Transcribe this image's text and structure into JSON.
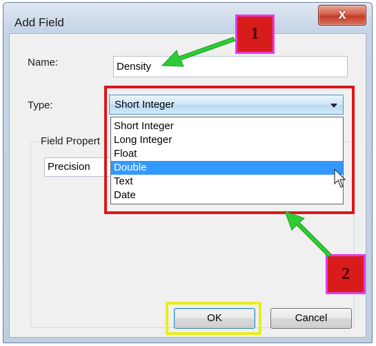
{
  "window": {
    "title": "Add Field",
    "close_label": "x"
  },
  "form": {
    "name_label": "Name:",
    "name_value": "Density",
    "type_label": "Type:",
    "type_selected": "Short Integer",
    "field_props_label": "Field Propert",
    "precision_label": "Precision"
  },
  "dropdown": {
    "options": [
      "Short Integer",
      "Long Integer",
      "Float",
      "Double",
      "Text",
      "Date"
    ],
    "highlighted": "Double"
  },
  "buttons": {
    "ok_label": "OK",
    "cancel_label": "Cancel"
  },
  "annotations": {
    "callout_1": "1",
    "callout_2": "2",
    "arrow_color": "#33cc33",
    "highlight_red": "#e01418",
    "highlight_yellow": "#e8ee1a"
  }
}
